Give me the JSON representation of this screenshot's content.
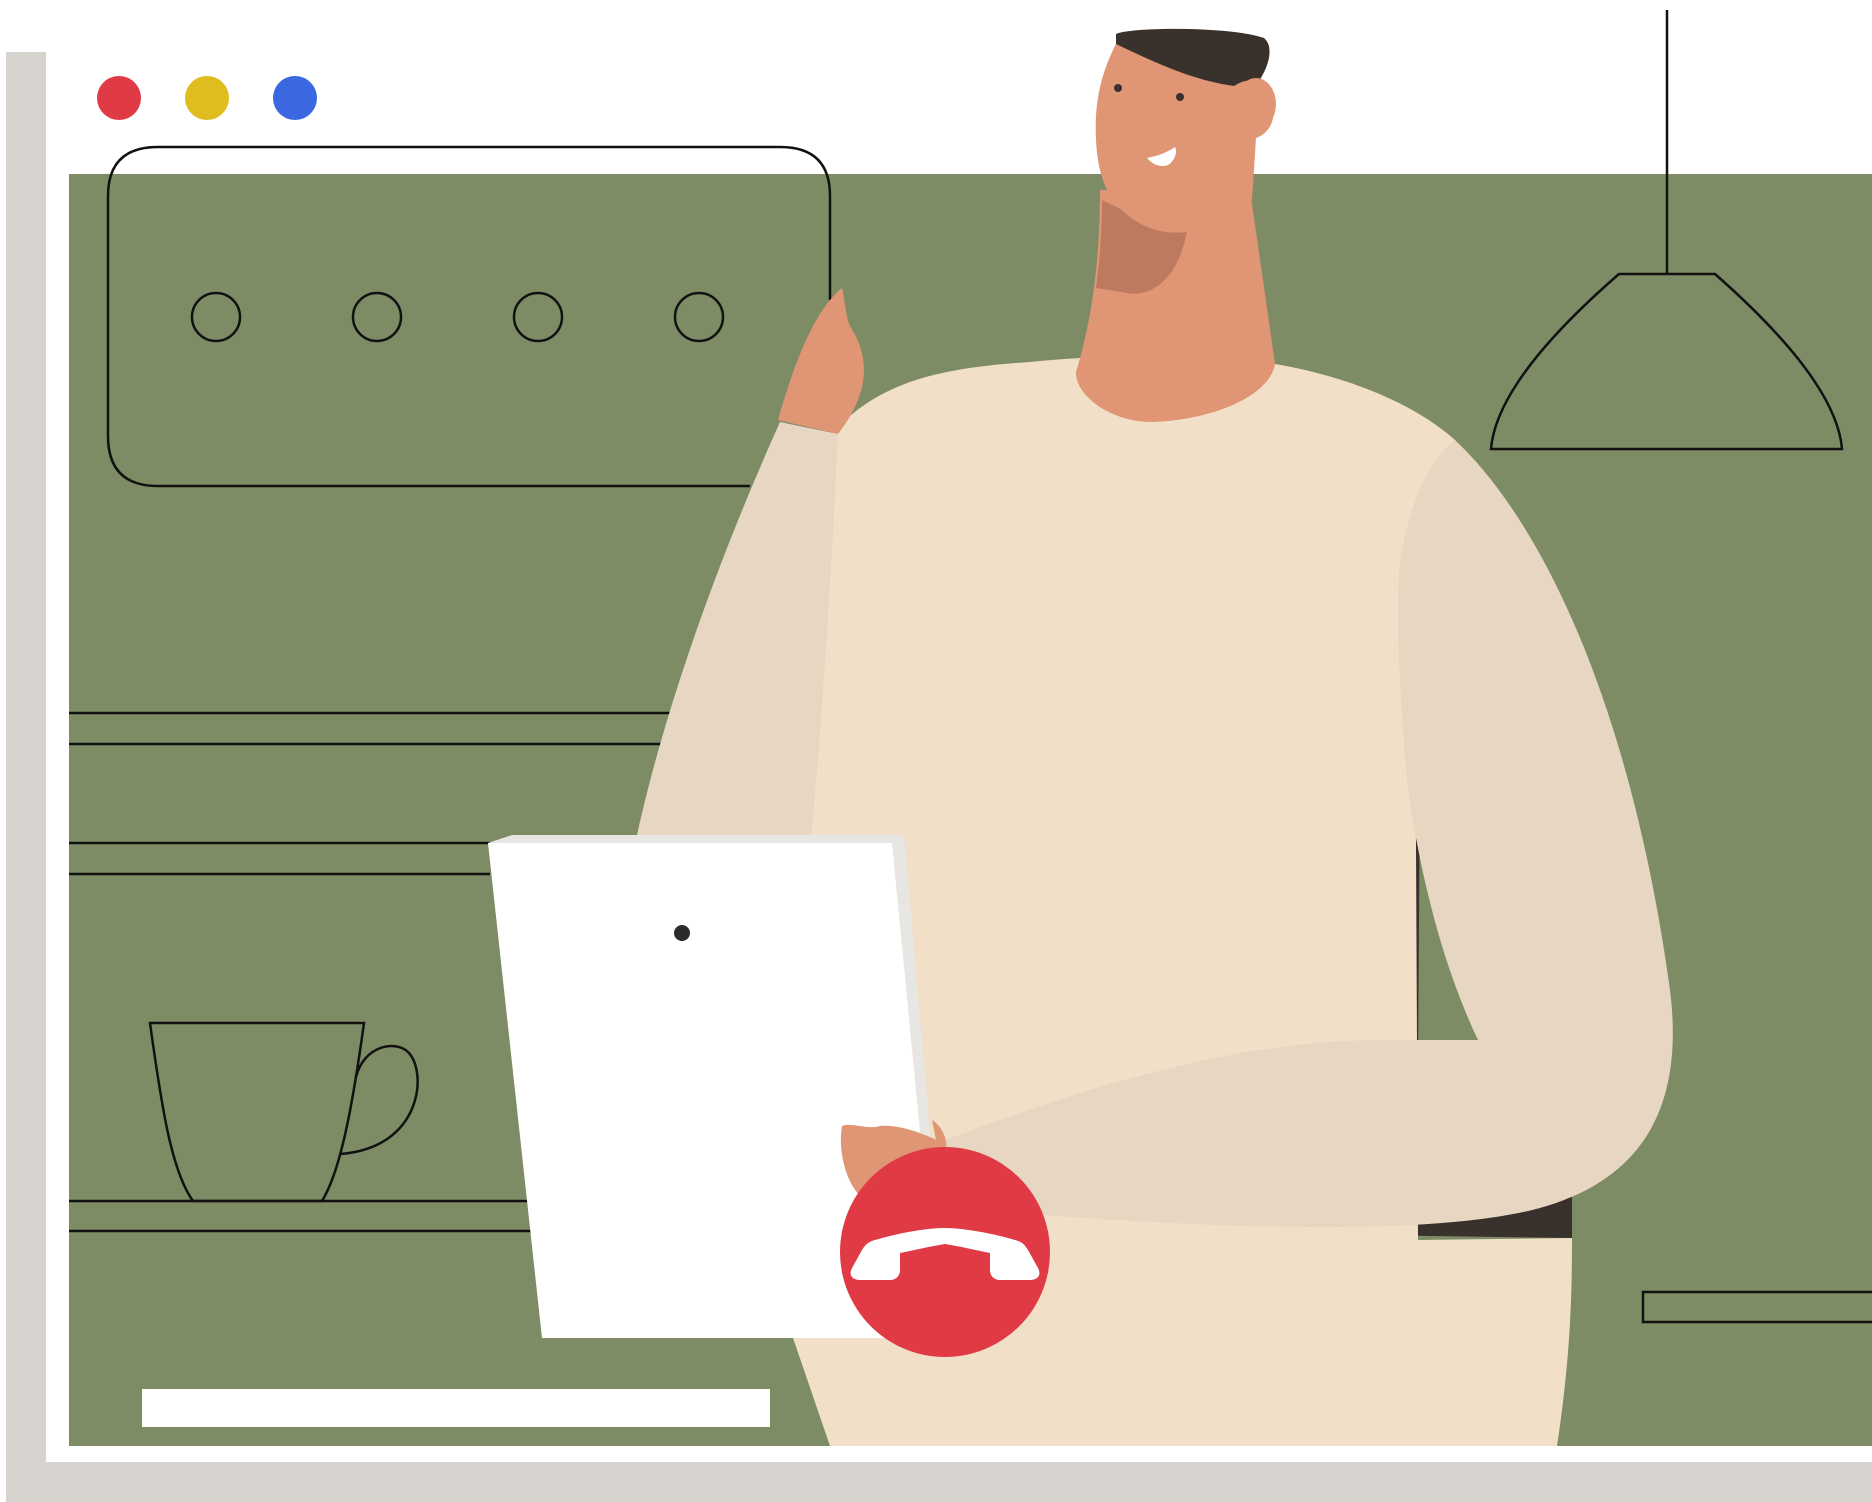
{
  "window": {
    "traffic_lights": [
      {
        "name": "close",
        "color": "#e03a45"
      },
      {
        "name": "minimize",
        "color": "#dfbc1f"
      },
      {
        "name": "maximize",
        "color": "#3b67e0"
      }
    ],
    "frame_shadow_color": "#d6d3ce",
    "frame_color": "#ffffff"
  },
  "scene": {
    "background_color": "#7e8c65",
    "line_color": "#111111",
    "text_bar_color": "#ffffff"
  },
  "person": {
    "skin_color": "#e09674",
    "skin_shadow_color": "#bd7a5f",
    "hair_color": "#38312c",
    "sweater_color": "#f1dfc8",
    "sweater_shadow_color": "#e7d6c2",
    "pants_color": "#38312c"
  },
  "tablet": {
    "screen_color": "#ffffff",
    "edge_color": "#e8e6e3",
    "camera_color": "#2b2b2b"
  },
  "call_controls": {
    "end_call_button": {
      "icon": "phone-hangup-icon",
      "color": "#e03a45",
      "icon_color": "#ffffff"
    }
  }
}
